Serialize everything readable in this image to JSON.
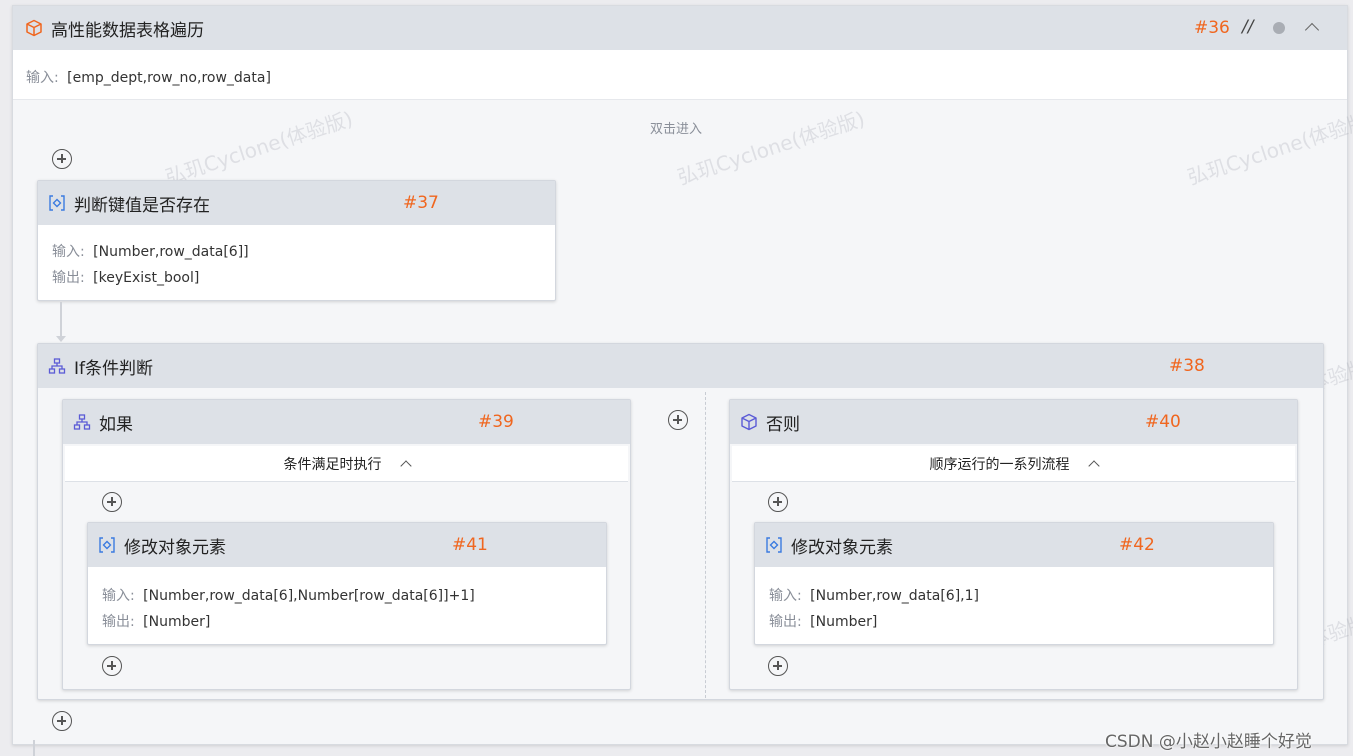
{
  "main_block": {
    "title": "高性能数据表格遍历",
    "id": "#36",
    "comment_icon": "//",
    "input_label": "输入:",
    "input_value": "[emp_dept,row_no,row_data]",
    "hint": "双击进入"
  },
  "key_exist_block": {
    "title": "判断键值是否存在",
    "id": "#37",
    "input_label": "输入:",
    "input_value": "[Number,row_data[6]]",
    "output_label": "输出:",
    "output_value": "[keyExist_bool]"
  },
  "if_block": {
    "title": "If条件判断",
    "id": "#38"
  },
  "then_branch": {
    "title": "如果",
    "id": "#39",
    "subtitle": "条件满足时执行"
  },
  "else_branch": {
    "title": "否则",
    "id": "#40",
    "subtitle": "顺序运行的一系列流程"
  },
  "modify_41": {
    "title": "修改对象元素",
    "id": "#41",
    "input_label": "输入:",
    "input_value": "[Number,row_data[6],Number[row_data[6]]+1]",
    "output_label": "输出:",
    "output_value": "[Number]"
  },
  "modify_42": {
    "title": "修改对象元素",
    "id": "#42",
    "input_label": "输入:",
    "input_value": "[Number,row_data[6],1]",
    "output_label": "输出:",
    "output_value": "[Number]"
  },
  "watermark_text": "弘玑Cyclone(体验版)",
  "footer_credit": "CSDN @小赵小赵睡个好觉",
  "colors": {
    "accent_orange": "#f0661f",
    "header_bg": "#dde1e7",
    "icon_blue": "#3b7be0",
    "icon_purple": "#5b5bd6"
  }
}
